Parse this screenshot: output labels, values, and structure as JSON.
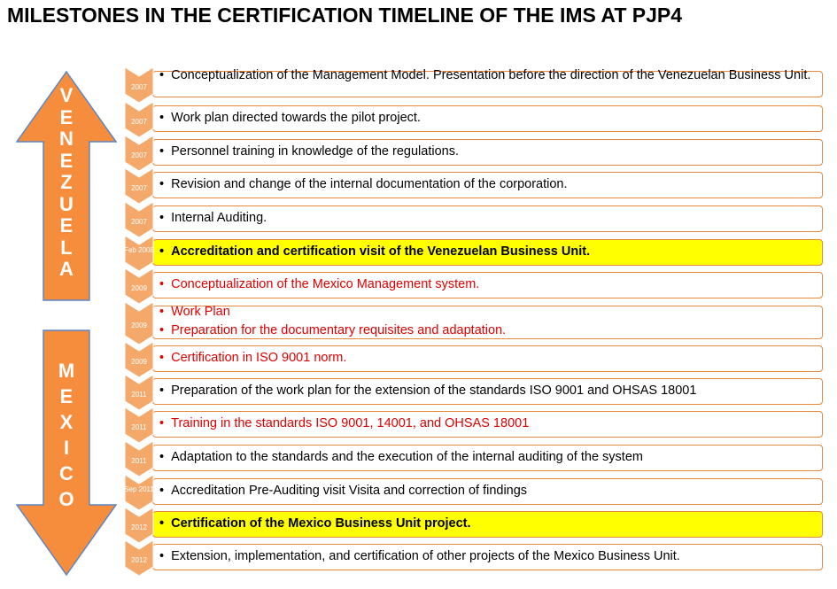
{
  "title": "MILESTONES IN THE CERTIFICATION TIMELINE OF THE IMS AT PJP4",
  "colors": {
    "arrow_fill": "#f68d3c",
    "arrow_stroke": "#5b87c5",
    "chevron_fill": "#f4a96b",
    "row_border": "#e8883a",
    "highlight": "#ffff00",
    "red_text": "#e00000"
  },
  "arrows": {
    "venezuela": {
      "label": "VENEZUELA",
      "direction": "up"
    },
    "mexico": {
      "label": "MEXICO",
      "direction": "down"
    }
  },
  "rows": [
    {
      "date": "2007",
      "lines": [
        "Conceptualization of the Management Model. Presentation before the direction of the Venezuelan Business Unit."
      ],
      "style": "normal"
    },
    {
      "date": "2007",
      "lines": [
        "Work plan directed towards the pilot project."
      ],
      "style": "normal"
    },
    {
      "date": "2007",
      "lines": [
        "Personnel training in knowledge of the regulations."
      ],
      "style": "normal"
    },
    {
      "date": "2007",
      "lines": [
        "Revision and change of the internal documentation of the corporation."
      ],
      "style": "normal"
    },
    {
      "date": "2007",
      "lines": [
        "Internal Auditing."
      ],
      "style": "normal"
    },
    {
      "date": "Feb 2008",
      "lines": [
        "Accreditation and certification visit of the Venezuelan Business Unit."
      ],
      "style": "highlight"
    },
    {
      "date": "2009",
      "lines": [
        "Conceptualization of the Mexico Management system."
      ],
      "style": "red"
    },
    {
      "date": "2009",
      "lines": [
        "Work Plan",
        "Preparation for the documentary requisites and adaptation."
      ],
      "style": "red"
    },
    {
      "date": "2009",
      "lines": [
        "Certification in ISO 9001 norm."
      ],
      "style": "red"
    },
    {
      "date": "2011",
      "lines": [
        "Preparation of the work plan for the extension of the standards ISO 9001 and OHSAS 18001"
      ],
      "style": "normal"
    },
    {
      "date": "2011",
      "lines": [
        "Training in the standards ISO 9001, 14001, and OHSAS 18001"
      ],
      "style": "red"
    },
    {
      "date": "2011",
      "lines": [
        "Adaptation to the standards and the execution of the internal auditing of the system"
      ],
      "style": "normal"
    },
    {
      "date": "Sep 2011",
      "lines": [
        "Accreditation Pre-Auditing visit Visita and correction of findings"
      ],
      "style": "normal"
    },
    {
      "date": "2012",
      "lines": [
        "Certification of the Mexico Business Unit project."
      ],
      "style": "highlight"
    },
    {
      "date": "2012",
      "lines": [
        "Extension, implementation, and certification of other projects of the Mexico Business Unit."
      ],
      "style": "normal"
    }
  ]
}
